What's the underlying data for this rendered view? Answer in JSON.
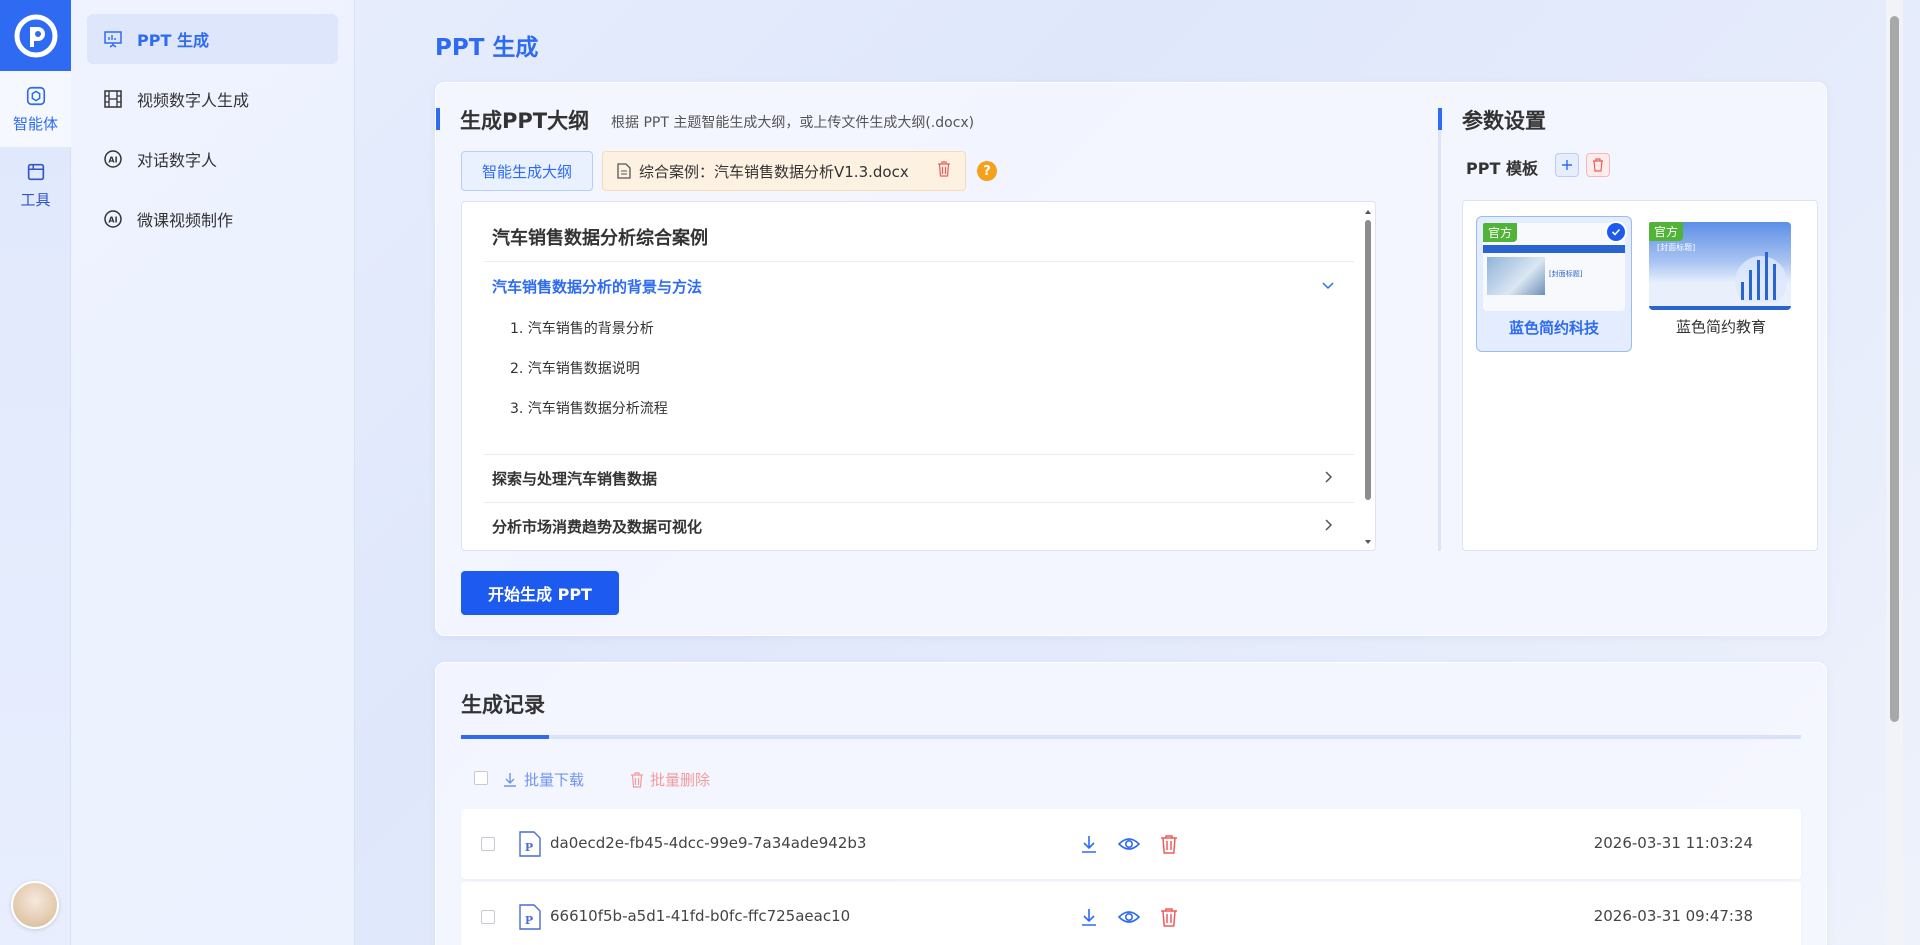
{
  "rail": {
    "items": [
      {
        "label": "智能体",
        "icon": "agent-icon",
        "active": true
      },
      {
        "label": "工具",
        "icon": "toolbox-icon",
        "active": false
      }
    ]
  },
  "subnav": {
    "items": [
      {
        "label": "PPT 生成",
        "icon": "presentation-icon",
        "active": true
      },
      {
        "label": "视频数字人生成",
        "icon": "film-icon",
        "active": false
      },
      {
        "label": "对话数字人",
        "icon": "ai-icon",
        "active": false
      },
      {
        "label": "微课视频制作",
        "icon": "ai-icon",
        "active": false
      }
    ]
  },
  "page": {
    "title": "PPT 生成"
  },
  "outline": {
    "title": "生成PPT大纲",
    "desc": "根据 PPT 主题智能生成大纲，或上传文件生成大纲(.docx)",
    "generate_button": "智能生成大纲",
    "file_name": "综合案例：汽车销售数据分析V1.3.docx",
    "help": "?",
    "doc_title": "汽车销售数据分析综合案例",
    "chapters": [
      {
        "title": "汽车销售数据分析的背景与方法",
        "expanded": true,
        "items": [
          "1. 汽车销售的背景分析",
          "2. 汽车销售数据说明",
          "3. 汽车销售数据分析流程"
        ]
      },
      {
        "title": "探索与处理汽车销售数据",
        "expanded": false
      },
      {
        "title": "分析市场消费趋势及数据可视化",
        "expanded": false
      }
    ],
    "start_button": "开始生成 PPT"
  },
  "params": {
    "title": "参数设置",
    "template_label": "PPT 模板",
    "templates": [
      {
        "name": "蓝色简约科技",
        "badge": "官方",
        "selected": true,
        "thumb_text": "[封面标题]"
      },
      {
        "name": "蓝色简约教育",
        "badge": "官方",
        "selected": false,
        "thumb_text": "[封面标题]"
      }
    ]
  },
  "records": {
    "title": "生成记录",
    "bulk_download": "批量下载",
    "bulk_delete": "批量删除",
    "rows": [
      {
        "name": "da0ecd2e-fb45-4dcc-99e9-7a34ade942b3",
        "time": "2026-03-31 11:03:24"
      },
      {
        "name": "66610f5b-a5d1-41fd-b0fc-ffc725aeac10",
        "time": "2026-03-31 09:47:38"
      }
    ]
  },
  "colors": {
    "primary": "#2e6bf2",
    "danger": "#f05a5a",
    "badge": "#52b339",
    "help": "#f5a11c"
  }
}
